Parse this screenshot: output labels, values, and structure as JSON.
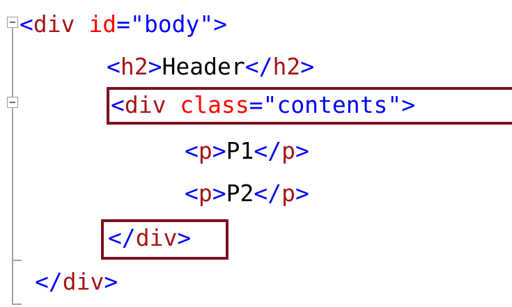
{
  "editor": {
    "lines": [
      {
        "indent": 0,
        "foldable": true,
        "tokens": {
          "open": "<",
          "tag": "div",
          "attr_name": "id",
          "eq": "=",
          "attr_value": "\"body\"",
          "close": ">"
        }
      },
      {
        "indent": 1,
        "foldable": false,
        "tokens": {
          "open": "<",
          "tag": "h2",
          "close": ">",
          "text": "Header",
          "end_open": "</",
          "end_tag": "h2",
          "end_close": ">"
        }
      },
      {
        "indent": 1,
        "foldable": true,
        "highlighted": true,
        "tokens": {
          "open": "<",
          "tag": "div",
          "attr_name": "class",
          "eq": "=",
          "attr_value": "\"contents\"",
          "close": ">"
        }
      },
      {
        "indent": 2,
        "foldable": false,
        "tokens": {
          "open": "<",
          "tag": "p",
          "close": ">",
          "text": "P1",
          "end_open": "</",
          "end_tag": "p",
          "end_close": ">"
        }
      },
      {
        "indent": 2,
        "foldable": false,
        "tokens": {
          "open": "<",
          "tag": "p",
          "close": ">",
          "text": "P2",
          "end_open": "</",
          "end_tag": "p",
          "end_close": ">"
        }
      },
      {
        "indent": 1,
        "foldable": false,
        "highlighted": true,
        "tokens": {
          "end_open": "</",
          "end_tag": "div",
          "end_close": ">"
        }
      },
      {
        "indent": 0,
        "foldable": false,
        "tokens": {
          "end_open": "</",
          "end_tag": "div",
          "end_close": ">"
        }
      }
    ]
  },
  "colors": {
    "punctuation": "#0000ff",
    "tag_name": "#a31515",
    "attribute_name": "#ff0000",
    "attribute_value": "#0000ff",
    "text": "#000000",
    "highlight_border": "#7b1020",
    "fold_gutter": "#a0a0a0"
  }
}
